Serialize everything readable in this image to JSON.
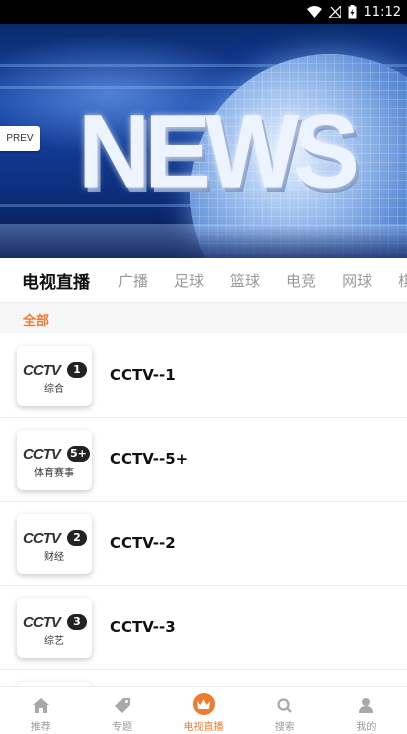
{
  "status_bar": {
    "time": "11:12",
    "icons": [
      "wifi-icon",
      "signal-icon",
      "battery-icon"
    ]
  },
  "banner": {
    "headline": "NEWS",
    "prev_label": "PREV"
  },
  "tabs": [
    {
      "label": "电视直播",
      "active": true
    },
    {
      "label": "广播",
      "active": false
    },
    {
      "label": "足球",
      "active": false
    },
    {
      "label": "篮球",
      "active": false
    },
    {
      "label": "电竞",
      "active": false
    },
    {
      "label": "网球",
      "active": false
    },
    {
      "label": "棋",
      "active": false
    }
  ],
  "filter": {
    "label": "全部"
  },
  "channels": [
    {
      "name": "CCTV--1",
      "logo_number": "1",
      "logo_subtitle": "综合"
    },
    {
      "name": "CCTV--5+",
      "logo_number": "5+",
      "logo_subtitle": "体育赛事"
    },
    {
      "name": "CCTV--2",
      "logo_number": "2",
      "logo_subtitle": "财经"
    },
    {
      "name": "CCTV--3",
      "logo_number": "3",
      "logo_subtitle": "综艺"
    }
  ],
  "logo_letters": "CCTV",
  "bottom_nav": [
    {
      "label": "推荐",
      "icon": "home-icon",
      "active": false
    },
    {
      "label": "专题",
      "icon": "tag-icon",
      "active": false
    },
    {
      "label": "电视直播",
      "icon": "crown-icon",
      "active": true
    },
    {
      "label": "搜索",
      "icon": "search-icon",
      "active": false
    },
    {
      "label": "我的",
      "icon": "user-icon",
      "active": false
    }
  ],
  "colors": {
    "accent": "#f07a2e",
    "status_bar": "#000000"
  }
}
